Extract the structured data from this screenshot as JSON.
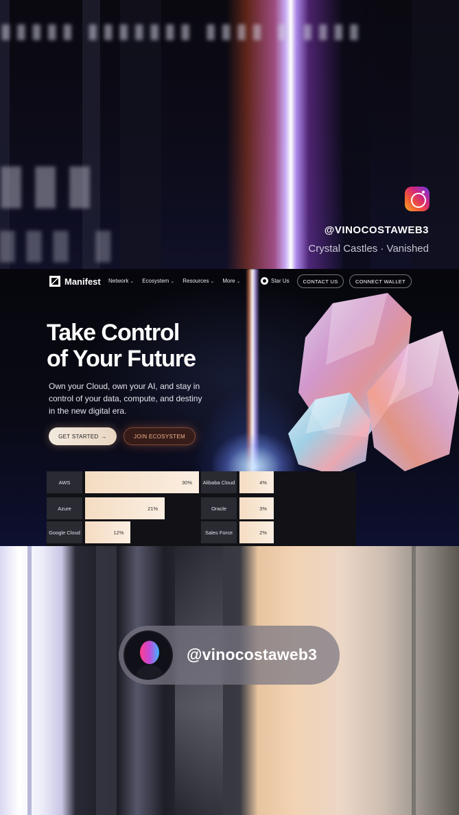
{
  "overlay": {
    "instagram_handle": "@VINOCOSTAWEB3",
    "song_credit": "Crystal Castles · Vanished",
    "creator_handle": "@vinocostaweb3"
  },
  "site": {
    "brand": "Manifest",
    "nav_items": [
      {
        "label": "Network"
      },
      {
        "label": "Ecosystem"
      },
      {
        "label": "Resources"
      },
      {
        "label": "More"
      }
    ],
    "star_label": "Star Us",
    "contact_label": "CONTACT US",
    "connect_label": "CONNECT WALLET",
    "hero_title_line1": "Take Control",
    "hero_title_line2": "of Your Future",
    "hero_subtitle": "Own your Cloud, own your AI, and stay in control of your data, compute, and destiny in the new digital era.",
    "cta_primary": "GET STARTED",
    "cta_secondary": "JOIN ECOSYSTEM"
  },
  "market_share": [
    {
      "label": "AWS",
      "value_text": "30%",
      "value": 30
    },
    {
      "label": "Alibaba Cloud",
      "value_text": "4%",
      "value": 4
    },
    {
      "label": "Azure",
      "value_text": "21%",
      "value": 21
    },
    {
      "label": "Oracle",
      "value_text": "3%",
      "value": 3
    },
    {
      "label": "Google Cloud",
      "value_text": "12%",
      "value": 12
    },
    {
      "label": "Sales Force",
      "value_text": "2%",
      "value": 2
    }
  ],
  "colors": {
    "bar_fill": "#f4dcc2",
    "accent_orange": "#f0b48c",
    "background": "#06060c"
  },
  "icons": [
    "instagram-icon",
    "manifest-logo-icon",
    "chevron-down-icon",
    "github-icon",
    "arrow-right-icon"
  ]
}
